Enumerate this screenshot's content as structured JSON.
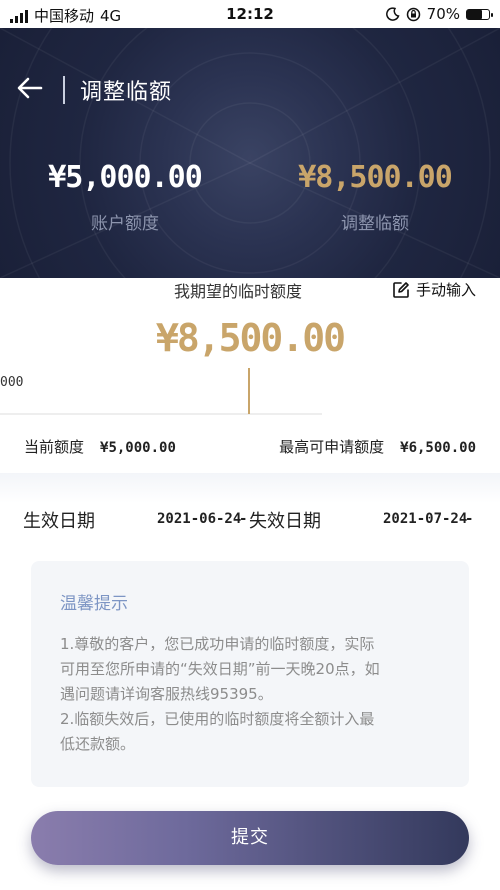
{
  "status_bar": {
    "carrier": "中国移动",
    "network": "4G",
    "time": "12:12",
    "battery": "70%",
    "battery_level": 70
  },
  "header": {
    "title": "调整临额",
    "account_amount": "¥5,000.00",
    "account_label": "账户额度",
    "adjust_amount": "¥8,500.00",
    "adjust_label": "调整临额"
  },
  "slider": {
    "expected_label": "我期望的临时额度",
    "manual_input_label": "手动输入",
    "expected_amount": "¥8,500.00",
    "ruler_text": "000",
    "current_label": "当前额度",
    "current_amount": "¥5,000.00",
    "max_label": "最高可申请额度",
    "max_amount": "¥6,500.00"
  },
  "dates": {
    "effective_label": "生效日期",
    "effective_date": "2021-06-24",
    "separator": "-",
    "expire_label": "失效日期",
    "expire_date": "2021-07-24",
    "trailing": "-"
  },
  "tips": {
    "title": "温馨提示",
    "line1": "1.尊敬的客户，您已成功申请的临时额度，实际",
    "line2": "可用至您所申请的“失效日期”前一天晚20点，如",
    "line3": "遇问题请详询客服热线95395。",
    "line4": "2.临额失效后，已使用的临时额度将全额计入最",
    "line5": "低还款额。"
  },
  "submit_label": "提交",
  "colors": {
    "gold": "#c9a56a",
    "header_dark": "#1f2641",
    "tips_title": "#7d95c4",
    "button_start": "#8a7dad",
    "button_end": "#33395c"
  }
}
